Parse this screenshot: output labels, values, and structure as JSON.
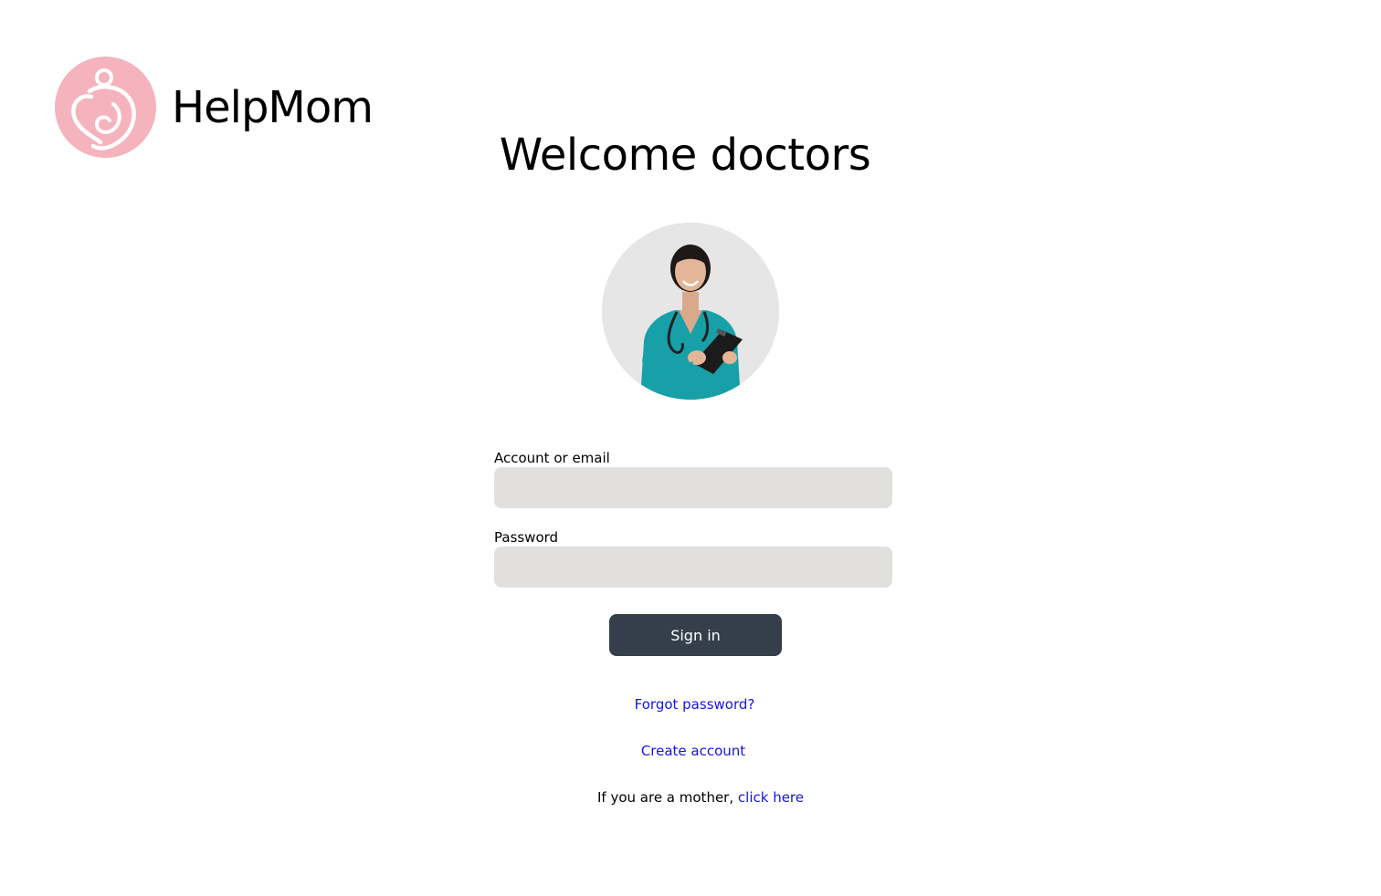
{
  "brand": {
    "name": "HelpMom",
    "logo_color": "#f5b3bd"
  },
  "page": {
    "title": "Welcome doctors"
  },
  "avatar": {
    "icon": "doctor-photo"
  },
  "form": {
    "account_label": "Account or email",
    "account_value": "",
    "password_label": "Password",
    "password_value": "",
    "signin_label": "Sign in"
  },
  "links": {
    "forgot_password": "Forgot password?",
    "create_account": "Create account",
    "mother_prompt": "If you are a mother,",
    "mother_link": "click here"
  },
  "colors": {
    "button_bg": "#343f4b",
    "input_bg": "#e2e0df",
    "link": "#1515e0"
  }
}
